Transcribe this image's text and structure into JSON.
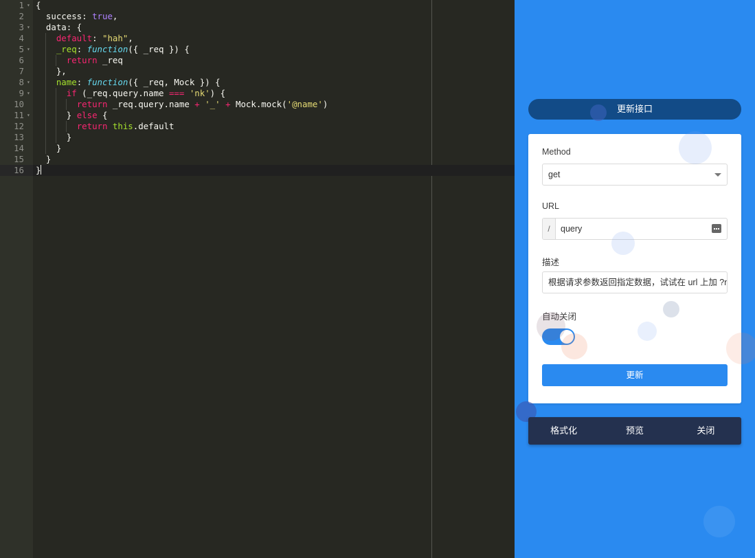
{
  "editor": {
    "line_numbers": [
      "1",
      "2",
      "3",
      "4",
      "5",
      "6",
      "7",
      "8",
      "9",
      "10",
      "11",
      "12",
      "13",
      "14",
      "15",
      "16"
    ],
    "lines": [
      "{",
      "  success: true,",
      "  data: {",
      "    default: \"hah\",",
      "    _req: function({ _req }) {",
      "      return _req",
      "    },",
      "    name: function({ _req, Mock }) {",
      "      if (_req.query.name === 'nk') {",
      "        return _req.query.name + '_' + Mock.mock('@name')",
      "      } else {",
      "        return this.default",
      "      }",
      "    }",
      "  }",
      "}"
    ],
    "foldable_lines": [
      1,
      3,
      5,
      8,
      9,
      11
    ],
    "active_line": 16
  },
  "panel": {
    "title": "更新接口",
    "method": {
      "label": "Method",
      "value": "get"
    },
    "url": {
      "label": "URL",
      "prefix": "/",
      "value": "query"
    },
    "description": {
      "label": "描述",
      "value": "根据请求参数返回指定数据，试试在 url 上加 ?name=nk"
    },
    "auto_close": {
      "label": "自动关闭",
      "enabled": true
    },
    "submit_label": "更新",
    "footer": {
      "format_label": "格式化",
      "preview_label": "预览",
      "close_label": "关闭"
    }
  },
  "colors": {
    "editor_bg": "#272822",
    "panel_bg": "#2a8af0",
    "header_pill": "#124b87",
    "footer_bar": "#24314f",
    "accent": "#2a8af0"
  }
}
